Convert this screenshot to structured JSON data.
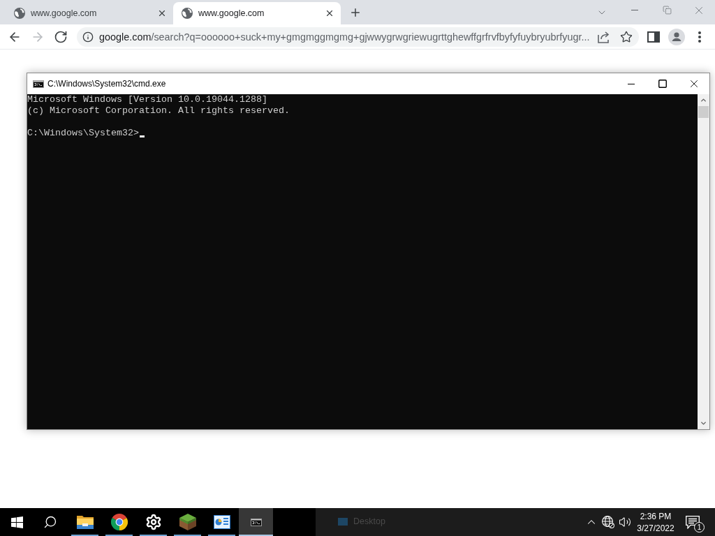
{
  "browser": {
    "tabs": [
      {
        "title": "www.google.com",
        "selected": false
      },
      {
        "title": "www.google.com",
        "selected": true
      }
    ],
    "nav_buttons": [
      {
        "kind": "back",
        "disabled": false
      },
      {
        "kind": "forward",
        "disabled": true
      },
      {
        "kind": "reload",
        "disabled": false
      }
    ],
    "address_bar": {
      "host": "google.com",
      "path": "/search?q=oooooo+suck+my+gmgmggmgmg+gjwwygrwgriewugrttghewffgrfrvfbyfyfuybryubrfyugr..."
    }
  },
  "cmd_window": {
    "title": "C:\\Windows\\System32\\cmd.exe",
    "output": [
      "Microsoft Windows [Version 10.0.19044.1288]",
      "(c) Microsoft Corporation. All rights reserved."
    ],
    "prompt": "C:\\Windows\\System32>"
  },
  "taskbar": {
    "apps": [
      {
        "kind": "file-explorer",
        "running": true,
        "selected": false
      },
      {
        "kind": "chrome",
        "running": true,
        "selected": false
      },
      {
        "kind": "settings",
        "running": true,
        "selected": false
      },
      {
        "kind": "minecraft",
        "running": true,
        "selected": false
      },
      {
        "kind": "control-panel",
        "running": true,
        "selected": false
      },
      {
        "kind": "cmd",
        "running": true,
        "selected": true
      }
    ],
    "ghost_label": "Desktop",
    "clock": {
      "time": "2:36 PM",
      "date": "3/27/2022"
    },
    "notifications": {
      "count": "1"
    }
  }
}
